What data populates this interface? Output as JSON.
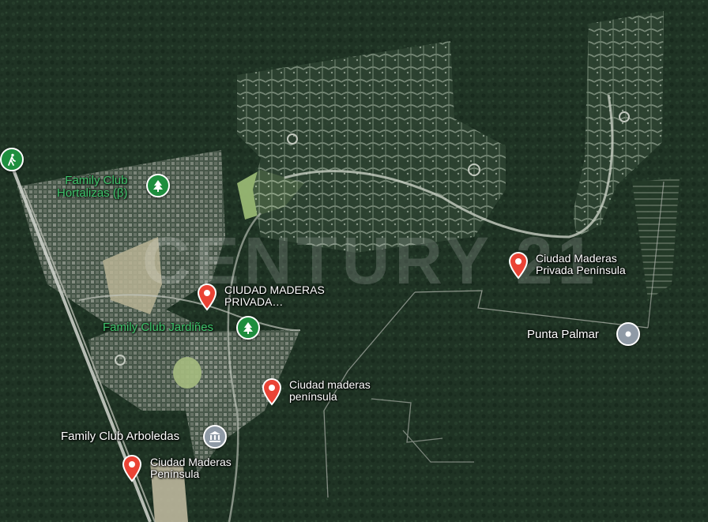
{
  "map": {
    "type": "satellite",
    "watermark_text": "CENTURY 21",
    "colors": {
      "place_pin": "#ea4335",
      "park_marker": "#1e8e3e",
      "park_label": "#3ec26a",
      "point_marker": "#8f9aa6"
    }
  },
  "places": [
    {
      "id": "family-club-hortalizas",
      "label": "Family Club\nHortalizas (β)",
      "marker": "tree-icon",
      "style": "park"
    },
    {
      "id": "ciudad-maderas-privada",
      "label": "CIUDAD MADERAS\nPRIVADA…",
      "marker": "location-pin-icon",
      "style": "place"
    },
    {
      "id": "family-club-jardines",
      "label": "Family Club Jardiñes",
      "marker": "tree-icon",
      "style": "park"
    },
    {
      "id": "ciudad-maderas-peninsula-lower",
      "label": "Ciudad maderas\npenínsula",
      "marker": "location-pin-icon",
      "style": "place"
    },
    {
      "id": "family-club-arboledas",
      "label": "Family Club Arboledas",
      "marker": "museum-icon",
      "style": "point"
    },
    {
      "id": "ciudad-maderas-peninsula-bottom",
      "label": "Ciudad Maderas\nPenínsula",
      "marker": "location-pin-icon",
      "style": "place"
    },
    {
      "id": "ciudad-maderas-privada-peninsula",
      "label": "Ciudad Maderas\nPrivada Península",
      "marker": "location-pin-icon",
      "style": "place"
    },
    {
      "id": "punta-palmar",
      "label": "Punta Palmar",
      "marker": "map-point-icon",
      "style": "point"
    },
    {
      "id": "hiking-trail",
      "label": "",
      "marker": "hiking-icon",
      "style": "park"
    }
  ]
}
